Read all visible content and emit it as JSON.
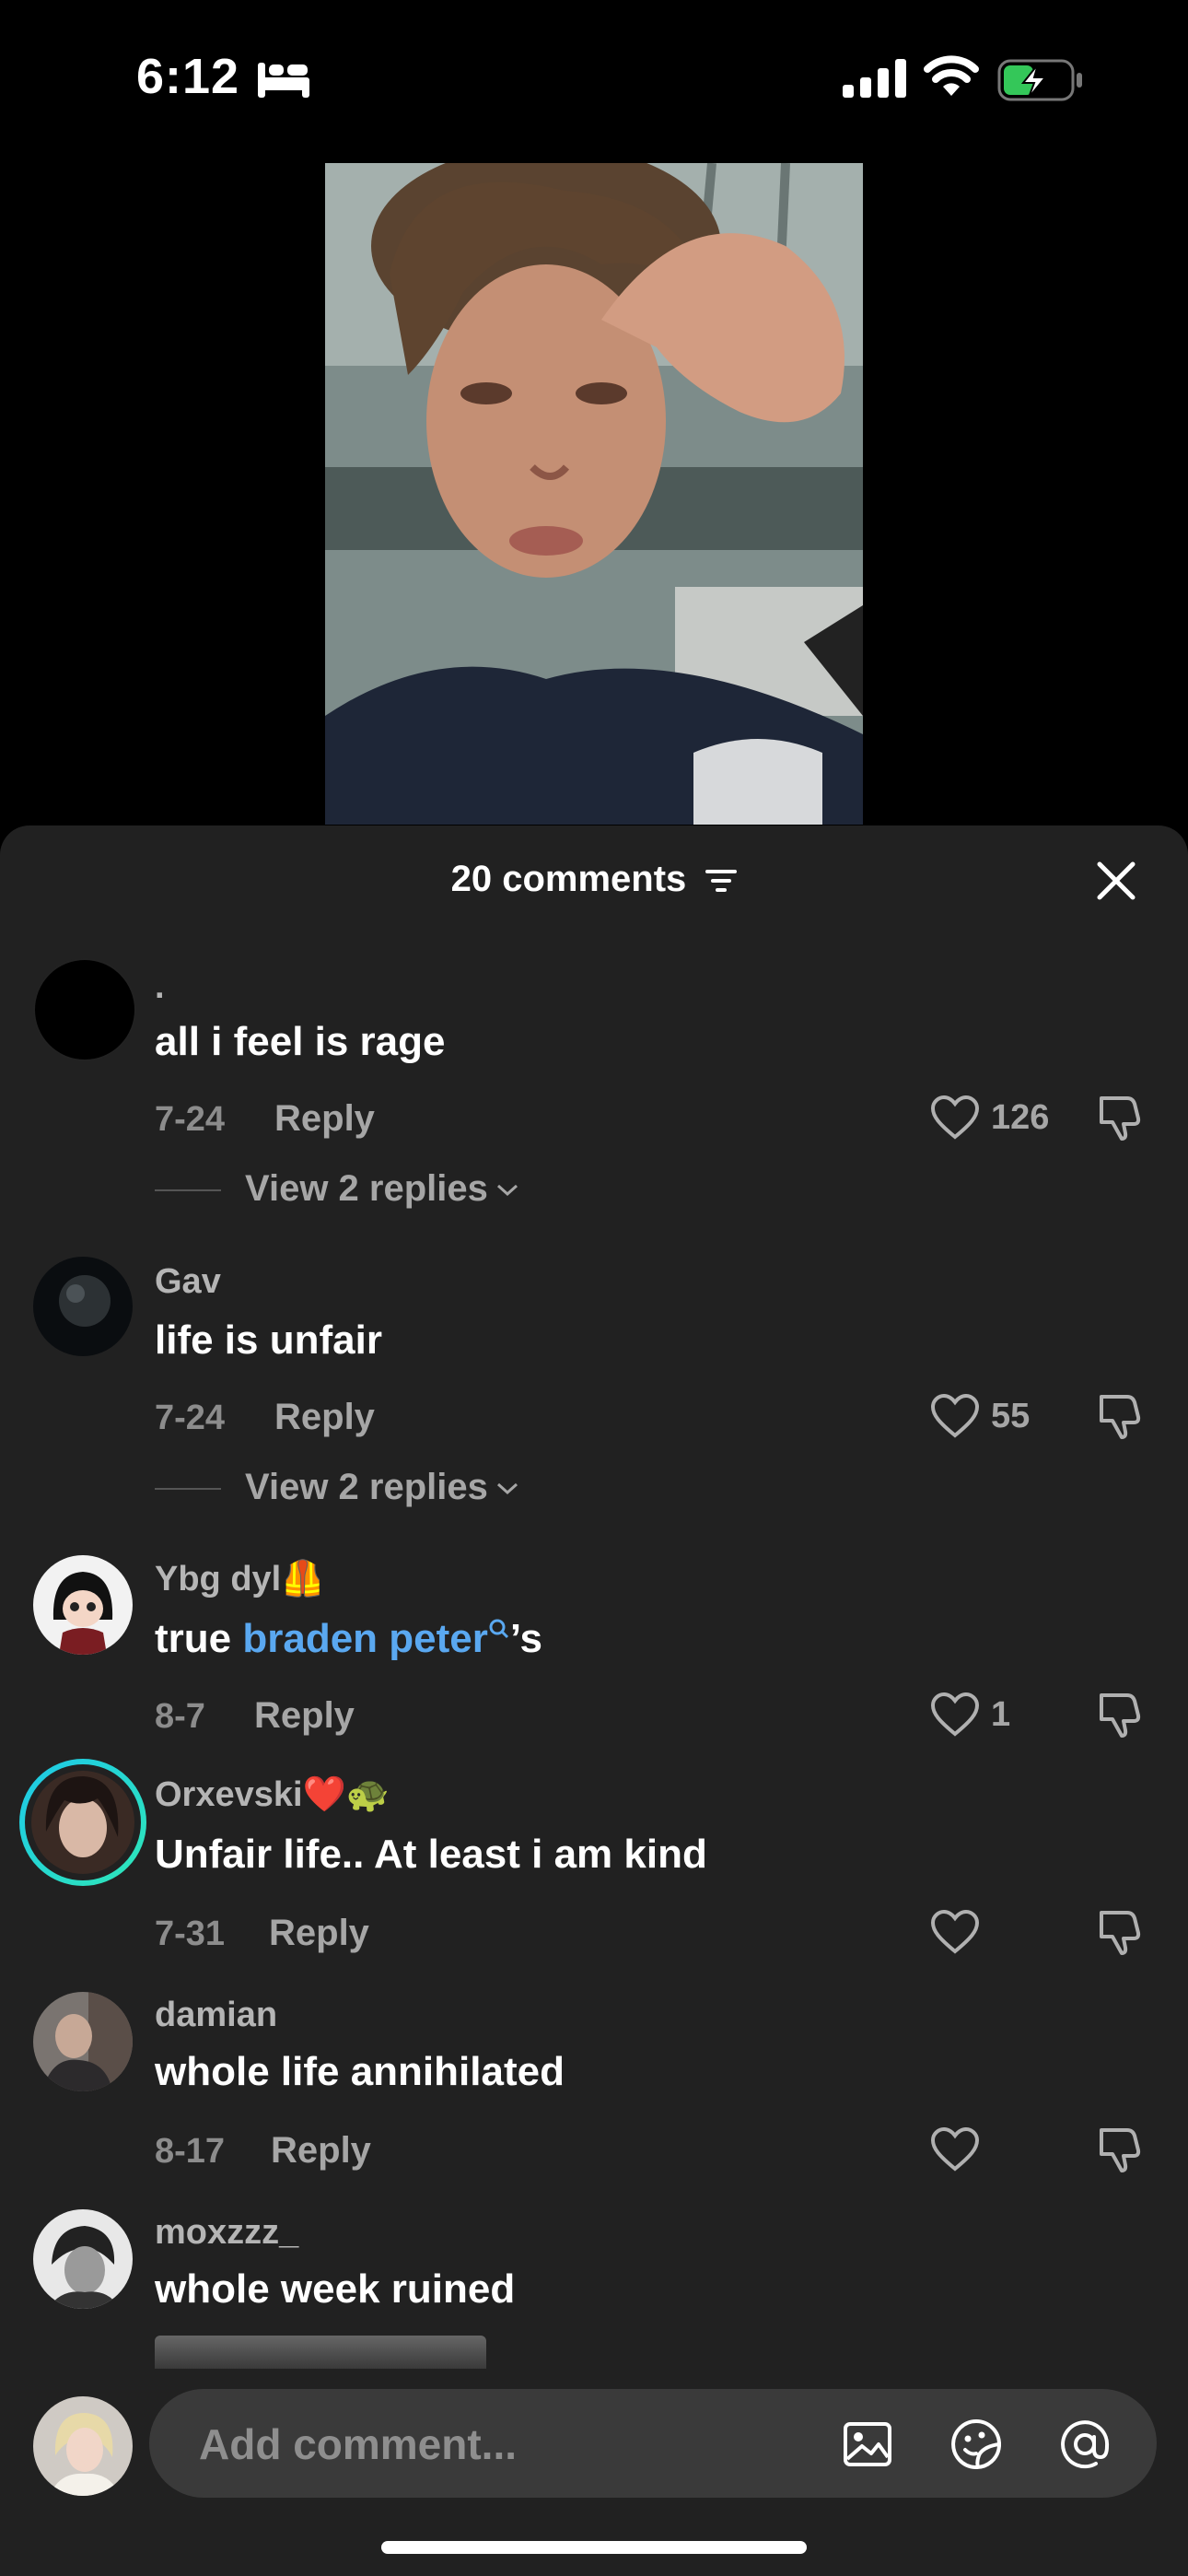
{
  "status_bar": {
    "time": "6:12",
    "icons": [
      "sleep-bed-icon",
      "cellular-signal-icon",
      "wifi-icon",
      "battery-charging-icon"
    ],
    "battery_color": "#34c759"
  },
  "video": {
    "description_icon": "video-thumbnail"
  },
  "comments_header": {
    "count_label": "20 comments",
    "filter_icon": "filter-icon",
    "close_icon": "close-icon"
  },
  "comments": [
    {
      "username": ".",
      "text": "all i feel is rage",
      "date": "7-24",
      "reply_label": "Reply",
      "likes": "126",
      "view_replies": "View 2 replies"
    },
    {
      "username": "Gav",
      "text": "life is unfair",
      "date": "7-24",
      "reply_label": "Reply",
      "likes": "55",
      "view_replies": "View 2 replies"
    },
    {
      "username": "Ybg dyl🦺",
      "text_prefix": "true ",
      "mention": "braden peter",
      "text_suffix": "’s",
      "date": "8-7",
      "reply_label": "Reply",
      "likes": "1"
    },
    {
      "username": "Orxevski❤️🐢",
      "text": "Unfair life.. At least i am kind",
      "date": "7-31",
      "reply_label": "Reply",
      "likes": ""
    },
    {
      "username": "damian",
      "text": "whole life annihilated",
      "date": "8-17",
      "reply_label": "Reply",
      "likes": ""
    },
    {
      "username": "moxzzz_",
      "text": "whole week ruined"
    }
  ],
  "input_bar": {
    "placeholder": "Add comment...",
    "icons": [
      "image-icon",
      "sticker-icon",
      "mention-icon"
    ]
  },
  "colors": {
    "sheet_bg": "#212121",
    "link": "#5aa8f0",
    "field_bg": "#3a3a3a"
  }
}
